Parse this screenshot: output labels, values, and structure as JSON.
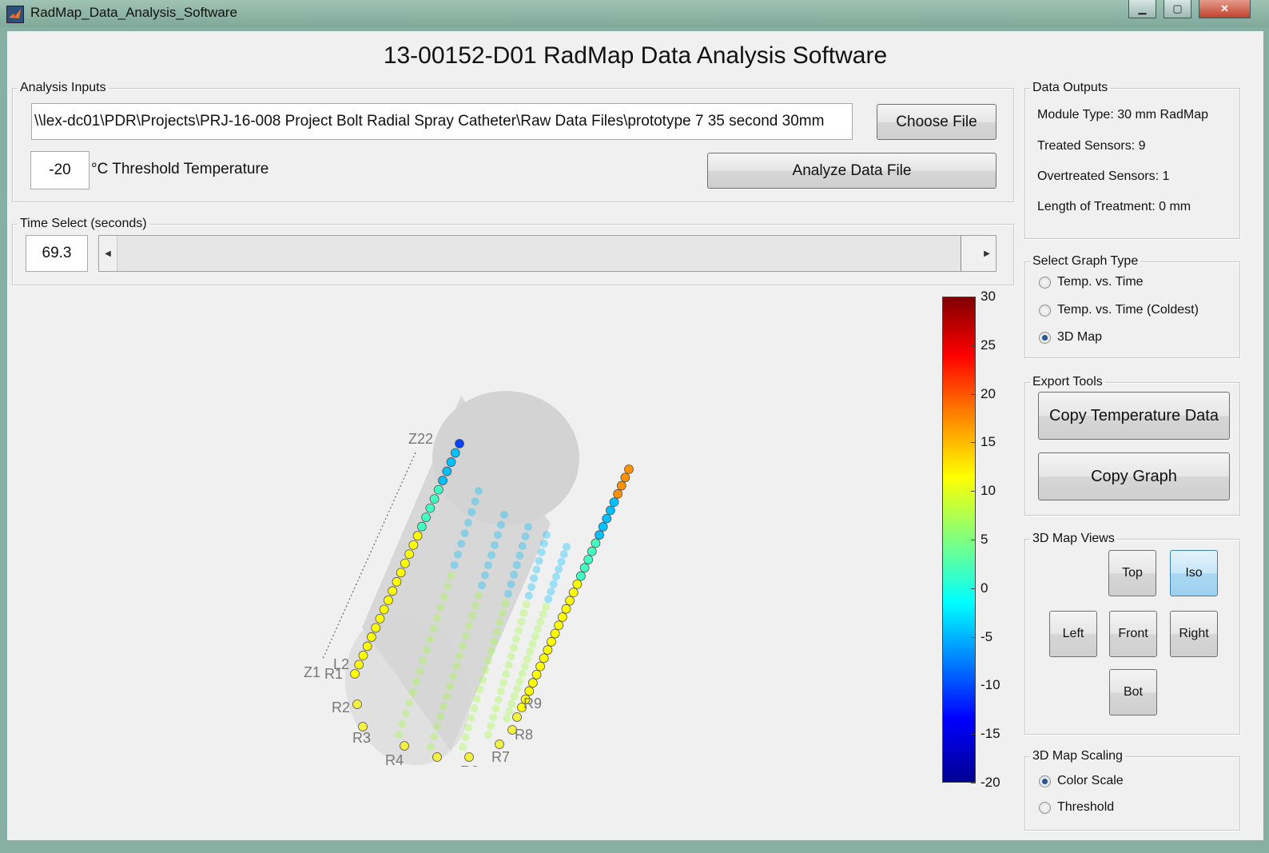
{
  "window": {
    "title": "RadMap_Data_Analysis_Software"
  },
  "main_title": "13-00152-D01 RadMap Data Analysis Software",
  "analysis_inputs": {
    "legend": "Analysis Inputs",
    "file_path": "\\\\lex-dc01\\PDR\\Projects\\PRJ-16-008 Project Bolt Radial Spray Catheter\\Raw Data Files\\prototype 7 35 second 30mm",
    "choose_file_label": "Choose File",
    "threshold_value": "-20",
    "threshold_label": "°C Threshold Temperature",
    "analyze_label": "Analyze Data File"
  },
  "time_select": {
    "legend": "Time Select (seconds)",
    "value": "69.3",
    "slider_fraction": 0.98
  },
  "data_outputs": {
    "legend": "Data Outputs",
    "module_type": "Module Type: 30 mm RadMap",
    "treated": "Treated Sensors: 9",
    "overtreated": "Overtreated Sensors: 1",
    "length": "Length of Treatment: 0 mm"
  },
  "graph_type": {
    "legend": "Select Graph Type",
    "options": [
      {
        "label": "Temp. vs. Time",
        "selected": false
      },
      {
        "label": "Temp. vs. Time (Coldest)",
        "selected": false
      },
      {
        "label": "3D Map",
        "selected": true
      }
    ]
  },
  "export_tools": {
    "legend": "Export Tools",
    "copy_temp": "Copy Temperature Data",
    "copy_graph": "Copy Graph"
  },
  "map_views": {
    "legend": "3D Map Views",
    "top": "Top",
    "iso": "Iso",
    "left": "Left",
    "front": "Front",
    "right": "Right",
    "bot": "Bot",
    "active": "Iso"
  },
  "map_scaling": {
    "legend": "3D Map Scaling",
    "options": [
      {
        "label": "Color Scale",
        "selected": true
      },
      {
        "label": "Threshold",
        "selected": false
      }
    ]
  },
  "colorbar": {
    "ticks": [
      "30",
      "25",
      "20",
      "15",
      "10",
      "5",
      "0",
      "-5",
      "-10",
      "-15",
      "-20"
    ],
    "min": -20,
    "max": 30
  },
  "plot_labels": {
    "z22": "Z22",
    "z1": "Z1",
    "l2": "L2",
    "r1": "R1",
    "r2": "R2",
    "r3": "R3",
    "r4": "R4",
    "r5": "R5",
    "r6": "R6",
    "r7": "R7",
    "r8": "R8",
    "r9": "R9"
  },
  "colors": {
    "window_bg": "#f0f0f0",
    "cylinder": "#d0d0d0",
    "active_button": "#a9d8f3"
  }
}
